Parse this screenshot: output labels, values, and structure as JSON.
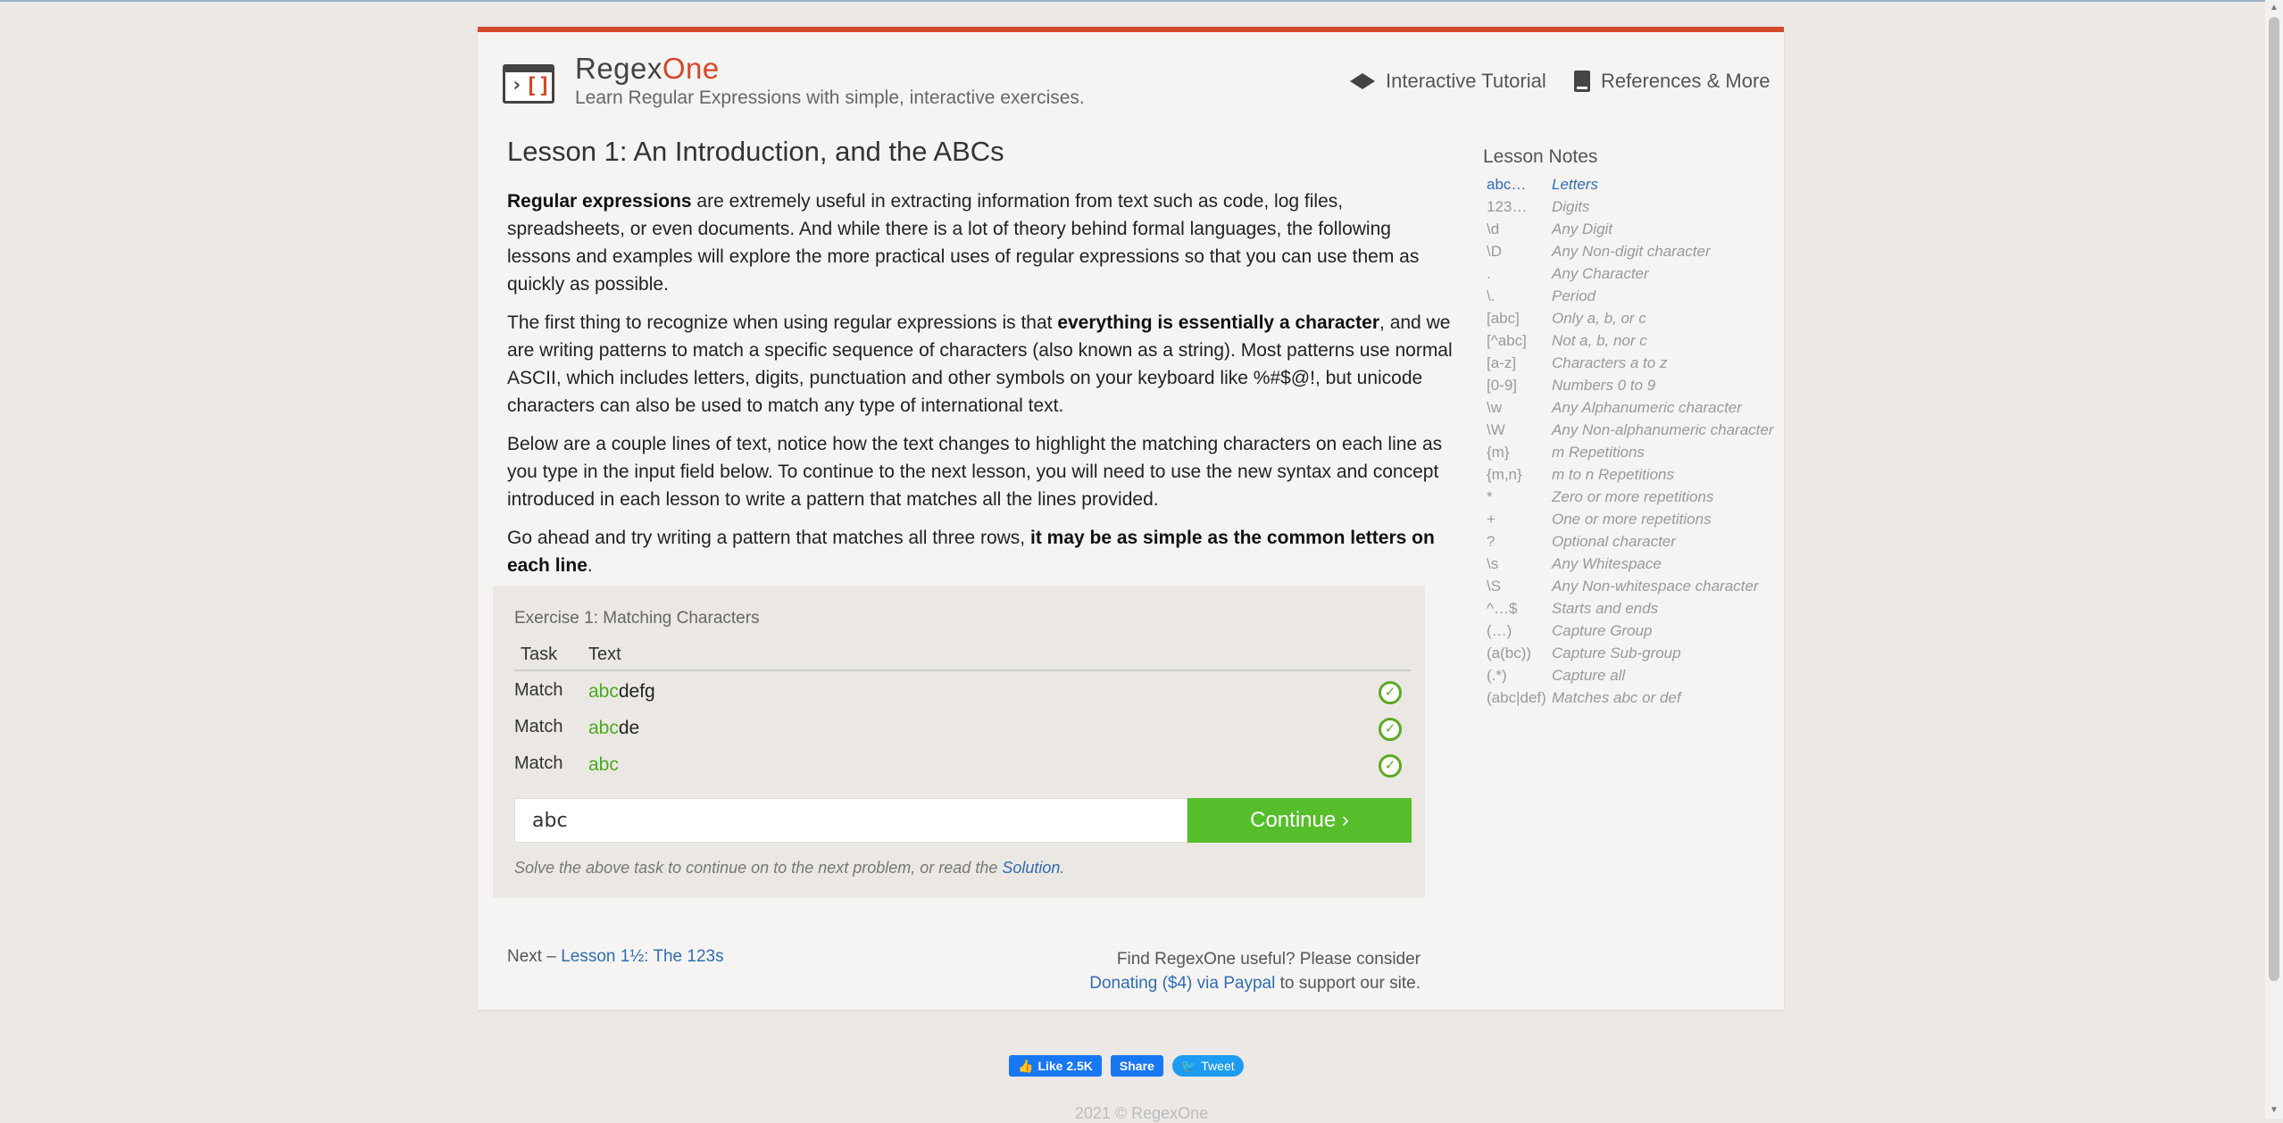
{
  "header": {
    "brand_part1": "Regex",
    "brand_part2": "One",
    "tagline": "Learn Regular Expressions with simple, interactive exercises.",
    "nav": {
      "tutorial": "Interactive Tutorial",
      "references": "References & More"
    }
  },
  "lesson": {
    "title": "Lesson 1: An Introduction, and the ABCs",
    "p1_bold": "Regular expressions",
    "p1_rest": " are extremely useful in extracting information from text such as code, log files, spreadsheets, or even documents. And while there is a lot of theory behind formal languages, the following lessons and examples will explore the more practical uses of regular expressions so that you can use them as quickly as possible.",
    "p2_a": "The first thing to recognize when using regular expressions is that ",
    "p2_bold": "everything is essentially a character",
    "p2_b": ", and we are writing patterns to match a specific sequence of characters (also known as a string). Most patterns use normal ASCII, which includes letters, digits, punctuation and other symbols on your keyboard like %#$@!, but unicode characters can also be used to match any type of international text.",
    "p3": "Below are a couple lines of text, notice how the text changes to highlight the matching characters on each line as you type in the input field below. To continue to the next lesson, you will need to use the new syntax and concept introduced in each lesson to write a pattern that matches all the lines provided.",
    "p4_a": "Go ahead and try writing a pattern that matches all three rows, ",
    "p4_bold": "it may be as simple as the common letters on each line",
    "p4_b": "."
  },
  "exercise": {
    "title": "Exercise 1: Matching Characters",
    "col_task": "Task",
    "col_text": "Text",
    "rows": [
      {
        "task": "Match",
        "match": "abc",
        "rest": "defg",
        "check": "✓"
      },
      {
        "task": "Match",
        "match": "abc",
        "rest": "de",
        "check": "✓"
      },
      {
        "task": "Match",
        "match": "abc",
        "rest": "",
        "check": "✓"
      }
    ],
    "input_value": "abc",
    "continue_label": "Continue ›",
    "hint_text": "Solve the above task to continue on to the next problem, or read the ",
    "hint_link": "Solution",
    "hint_end": "."
  },
  "next": {
    "prefix": "Next – ",
    "link": "Lesson 1½: The 123s"
  },
  "donate": {
    "line1": "Find RegexOne useful? Please consider",
    "link": "Donating ($4) via Paypal",
    "tail": " to support our site."
  },
  "notes": {
    "title": "Lesson Notes",
    "items": [
      {
        "pattern": "abc…",
        "desc": "Letters"
      },
      {
        "pattern": "123…",
        "desc": "Digits"
      },
      {
        "pattern": "\\d",
        "desc": "Any Digit"
      },
      {
        "pattern": "\\D",
        "desc": "Any Non-digit character"
      },
      {
        "pattern": ".",
        "desc": "Any Character"
      },
      {
        "pattern": "\\.",
        "desc": "Period"
      },
      {
        "pattern": "[abc]",
        "desc": "Only a, b, or c"
      },
      {
        "pattern": "[^abc]",
        "desc": "Not a, b, nor c"
      },
      {
        "pattern": "[a-z]",
        "desc": "Characters a to z"
      },
      {
        "pattern": "[0-9]",
        "desc": "Numbers 0 to 9"
      },
      {
        "pattern": "\\w",
        "desc": "Any Alphanumeric character"
      },
      {
        "pattern": "\\W",
        "desc": "Any Non-alphanumeric character"
      },
      {
        "pattern": "{m}",
        "desc": "m Repetitions"
      },
      {
        "pattern": "{m,n}",
        "desc": "m to n Repetitions"
      },
      {
        "pattern": "*",
        "desc": "Zero or more repetitions"
      },
      {
        "pattern": "+",
        "desc": "One or more repetitions"
      },
      {
        "pattern": "?",
        "desc": "Optional character"
      },
      {
        "pattern": "\\s",
        "desc": "Any Whitespace"
      },
      {
        "pattern": "\\S",
        "desc": "Any Non-whitespace character"
      },
      {
        "pattern": "^…$",
        "desc": "Starts and ends"
      },
      {
        "pattern": "(…)",
        "desc": "Capture Group"
      },
      {
        "pattern": "(a(bc))",
        "desc": "Capture Sub-group"
      },
      {
        "pattern": "(.*)",
        "desc": "Capture all"
      },
      {
        "pattern": "(abc|def)",
        "desc": "Matches abc or def"
      }
    ]
  },
  "social": {
    "like": "Like 2.5K",
    "share": "Share",
    "tweet": "Tweet"
  },
  "footer": "2021 © RegexOne",
  "colors": {
    "accent": "#d2492a",
    "link": "#2f6db5",
    "success": "#56be2b"
  }
}
